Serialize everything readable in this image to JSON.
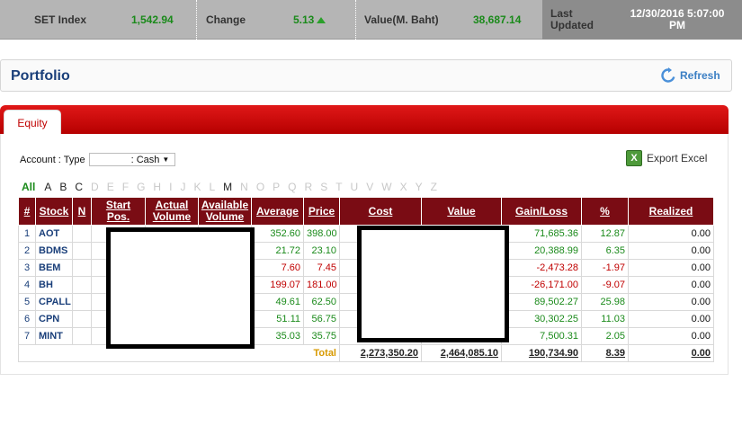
{
  "ticker": {
    "set_index_label": "SET Index",
    "set_index_value": "1,542.94",
    "change_label": "Change",
    "change_value": "5.13",
    "value_label": "Value(M. Baht)",
    "value_value": "38,687.14",
    "last_updated_label_1": "Last",
    "last_updated_label_2": "Updated",
    "last_updated_value_1": "12/30/2016 5:07:00",
    "last_updated_value_2": "PM"
  },
  "portfolio": {
    "title": "Portfolio",
    "refresh_label": "Refresh"
  },
  "tabs": {
    "equity": "Equity"
  },
  "account": {
    "label": "Account : Type",
    "type_value": ": Cash"
  },
  "export_label": "Export Excel",
  "alphabet": {
    "all": "All",
    "letters": [
      {
        "l": "A",
        "on": true
      },
      {
        "l": "B",
        "on": true
      },
      {
        "l": "C",
        "on": true
      },
      {
        "l": "D",
        "on": false
      },
      {
        "l": "E",
        "on": false
      },
      {
        "l": "F",
        "on": false
      },
      {
        "l": "G",
        "on": false
      },
      {
        "l": "H",
        "on": false
      },
      {
        "l": "I",
        "on": false
      },
      {
        "l": "J",
        "on": false
      },
      {
        "l": "K",
        "on": false
      },
      {
        "l": "L",
        "on": false
      },
      {
        "l": "M",
        "on": true
      },
      {
        "l": "N",
        "on": false
      },
      {
        "l": "O",
        "on": false
      },
      {
        "l": "P",
        "on": false
      },
      {
        "l": "Q",
        "on": false
      },
      {
        "l": "R",
        "on": false
      },
      {
        "l": "S",
        "on": false
      },
      {
        "l": "T",
        "on": false
      },
      {
        "l": "U",
        "on": false
      },
      {
        "l": "V",
        "on": false
      },
      {
        "l": "W",
        "on": false
      },
      {
        "l": "X",
        "on": false
      },
      {
        "l": "Y",
        "on": false
      },
      {
        "l": "Z",
        "on": false
      }
    ]
  },
  "table": {
    "headers": {
      "num": "#",
      "stock": "Stock",
      "n": "N",
      "start_pos": "Start Pos.",
      "actual_1": "Actual",
      "actual_2": "Volume",
      "available_1": "Available",
      "available_2": "Volume",
      "average": "Average",
      "price": "Price",
      "cost": "Cost",
      "value": "Value",
      "gain_loss": "Gain/Loss",
      "pct": "%",
      "realized": "Realized"
    },
    "rows": [
      {
        "num": "1",
        "stock": "AOT",
        "average": "352.60",
        "price": "398.00",
        "gain": "71,685.36",
        "pct": "12.87",
        "realized": "0.00",
        "dir": "pos"
      },
      {
        "num": "2",
        "stock": "BDMS",
        "average": "21.72",
        "price": "23.10",
        "gain": "20,388.99",
        "pct": "6.35",
        "realized": "0.00",
        "dir": "pos"
      },
      {
        "num": "3",
        "stock": "BEM",
        "average": "7.60",
        "price": "7.45",
        "gain": "-2,473.28",
        "pct": "-1.97",
        "realized": "0.00",
        "dir": "neg"
      },
      {
        "num": "4",
        "stock": "BH",
        "average": "199.07",
        "price": "181.00",
        "gain": "-26,171.00",
        "pct": "-9.07",
        "realized": "0.00",
        "dir": "neg"
      },
      {
        "num": "5",
        "stock": "CPALL",
        "average": "49.61",
        "price": "62.50",
        "gain": "89,502.27",
        "pct": "25.98",
        "realized": "0.00",
        "dir": "pos"
      },
      {
        "num": "6",
        "stock": "CPN",
        "average": "51.11",
        "price": "56.75",
        "gain": "30,302.25",
        "pct": "11.03",
        "realized": "0.00",
        "dir": "pos"
      },
      {
        "num": "7",
        "stock": "MINT",
        "average": "35.03",
        "price": "35.75",
        "gain": "7,500.31",
        "pct": "2.05",
        "realized": "0.00",
        "dir": "pos"
      }
    ],
    "total": {
      "label": "Total",
      "cost": "2,273,350.20",
      "value": "2,464,085.10",
      "gain": "190,734.90",
      "pct": "8.39",
      "realized": "0.00"
    }
  },
  "colors": {
    "header_bg": "#7a0c14",
    "tab_red": "#d00000",
    "positive": "#1a8a1a",
    "negative": "#c00000",
    "link_blue": "#1a3f7a"
  }
}
